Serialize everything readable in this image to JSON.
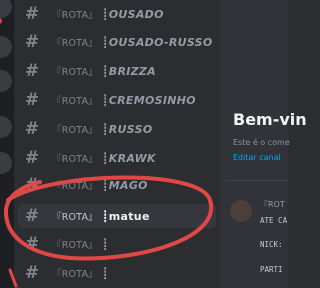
{
  "guild_rail": {
    "icons": [
      "server-icon",
      "server-icon",
      "server-icon",
      "server-icon",
      "server-icon"
    ],
    "badge_color": "#f23f42"
  },
  "channels": {
    "hash_symbol": "#",
    "items": [
      {
        "prefix": "『ROTA』",
        "name": "┋OUSADO",
        "selected": false
      },
      {
        "prefix": "『ROTA』",
        "name": "┋OUSADO-RUSSO",
        "selected": false
      },
      {
        "prefix": "『ROTA』",
        "name": "┋BRIZZA",
        "selected": false
      },
      {
        "prefix": "『ROTA』",
        "name": "┋CREMOSINHO",
        "selected": false
      },
      {
        "prefix": "『ROTA』",
        "name": "┋RUSSO",
        "selected": false
      },
      {
        "prefix": "『ROTA』",
        "name": "┋KRAWK",
        "selected": false
      },
      {
        "prefix": "『ROTA』",
        "name": "┋MAGO",
        "selected": false
      },
      {
        "prefix": "『ROTA』",
        "name": "┋matue",
        "selected": true
      },
      {
        "prefix": "『ROTA』",
        "name": "┋",
        "selected": false
      },
      {
        "prefix": "『ROTA』",
        "name": "┋",
        "selected": false
      }
    ]
  },
  "main": {
    "welcome_title": "Bem-vin",
    "welcome_desc": "Este é o come",
    "edit_link": "Editar canal",
    "message": {
      "line1": "『ROT",
      "line2": "ATE CA",
      "line3": "NICK:",
      "line4": "PARTI"
    }
  },
  "colors": {
    "sidebar_bg": "#2b2d31",
    "main_bg": "#313338",
    "selected_bg": "#35373c",
    "link": "#00a8fc",
    "annotation_stroke": "#e04848"
  }
}
